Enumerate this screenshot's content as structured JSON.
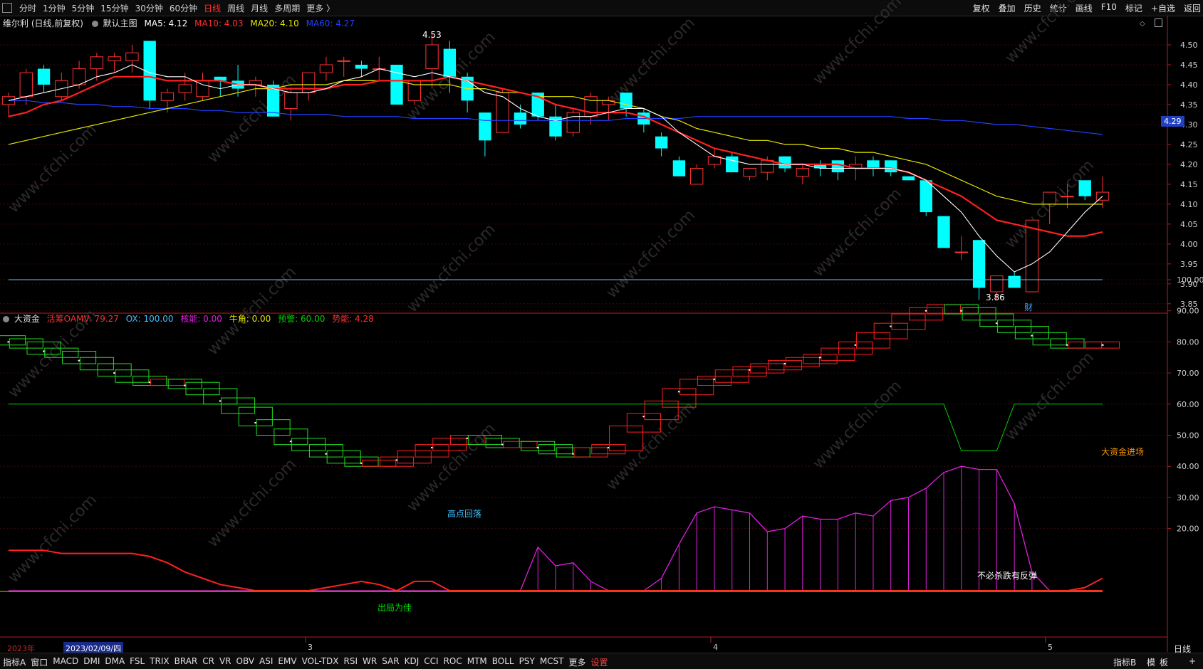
{
  "toolbar": {
    "periods": [
      "分时",
      "1分钟",
      "5分钟",
      "15分钟",
      "30分钟",
      "60分钟",
      "日线",
      "周线",
      "月线",
      "多周期",
      "更多 〉"
    ],
    "active_period": "日线",
    "right_tools": [
      "复权",
      "叠加",
      "历史",
      "统计",
      "画线",
      "F10",
      "标记",
      "+自选",
      "返回"
    ]
  },
  "main_legend": {
    "stock": "维尔利 (日线,前复权)",
    "template": "默认主图",
    "ma5": "MA5: 4.12",
    "ma10": "MA10: 4.03",
    "ma20": "MA20: 4.10",
    "ma60": "MA60: 4.27"
  },
  "sub_legend": {
    "name": "大资金",
    "oamv": "活筹OAMV: 79.27",
    "ox": "OX: 100.00",
    "core": "核能: 0.00",
    "bull": "牛角: 0.00",
    "warn": "预警: 60.00",
    "power": "势能: 4.28"
  },
  "annotations": {
    "high": "4.53",
    "low": "3.86",
    "cai": "财",
    "enter": "大资金进场",
    "pullback": "高点回落",
    "exit": "出局为佳",
    "rebound": "不必杀跌有反弹"
  },
  "current_price": "4.29",
  "date_axis": {
    "year": "2023年",
    "cursor_date": "2023/02/09/四",
    "months": [
      "3",
      "4",
      "5"
    ],
    "period": "日线"
  },
  "indicators": [
    "指标A",
    "窗口",
    "MACD",
    "DMI",
    "DMA",
    "FSL",
    "TRIX",
    "BRAR",
    "CR",
    "VR",
    "OBV",
    "ASI",
    "EMV",
    "VOL-TDX",
    "RSI",
    "WR",
    "SAR",
    "KDJ",
    "CCI",
    "ROC",
    "MTM",
    "BOLL",
    "PSY",
    "MCST",
    "更多",
    "设置"
  ],
  "bottom_right": [
    "指标B",
    "模",
    "板",
    "+"
  ],
  "watermark": "www.cfchi.com",
  "colors": {
    "up": "#ff3232",
    "down": "#00ffff",
    "ma5": "#ffffff",
    "ma10": "#ff2020",
    "ma20": "#e6e600",
    "ma60": "#2040ff",
    "green": "#00d000",
    "magenta": "#e020e0",
    "orange": "#ff9900"
  },
  "chart_data": [
    {
      "type": "candlestick",
      "title": "维尔利 (日线,前复权)",
      "ylim": [
        3.83,
        4.55
      ],
      "y_ticks": [
        4.5,
        4.45,
        4.4,
        4.35,
        4.3,
        4.25,
        4.2,
        4.15,
        4.1,
        4.05,
        4.0,
        3.95,
        3.9,
        3.85
      ],
      "candles": [
        [
          4.35,
          4.38,
          4.32,
          4.37
        ],
        [
          4.37,
          4.44,
          4.35,
          4.43
        ],
        [
          4.44,
          4.45,
          4.38,
          4.4
        ],
        [
          4.37,
          4.43,
          4.36,
          4.41
        ],
        [
          4.4,
          4.46,
          4.39,
          4.44
        ],
        [
          4.44,
          4.48,
          4.41,
          4.47
        ],
        [
          4.46,
          4.48,
          4.43,
          4.47
        ],
        [
          4.46,
          4.5,
          4.43,
          4.48
        ],
        [
          4.51,
          4.51,
          4.34,
          4.36
        ],
        [
          4.36,
          4.39,
          4.33,
          4.38
        ],
        [
          4.38,
          4.43,
          4.36,
          4.4
        ],
        [
          4.37,
          4.43,
          4.36,
          4.41
        ],
        [
          4.42,
          4.42,
          4.37,
          4.41
        ],
        [
          4.41,
          4.45,
          4.37,
          4.39
        ],
        [
          4.4,
          4.42,
          4.37,
          4.41
        ],
        [
          4.4,
          4.41,
          4.32,
          4.32
        ],
        [
          4.34,
          4.39,
          4.31,
          4.38
        ],
        [
          4.38,
          4.43,
          4.36,
          4.43
        ],
        [
          4.43,
          4.47,
          4.41,
          4.45
        ],
        [
          4.46,
          4.47,
          4.42,
          4.46
        ],
        [
          4.45,
          4.46,
          4.42,
          4.44
        ],
        [
          4.44,
          4.47,
          4.41,
          4.44
        ],
        [
          4.45,
          4.45,
          4.35,
          4.35
        ],
        [
          4.36,
          4.41,
          4.35,
          4.41
        ],
        [
          4.44,
          4.53,
          4.39,
          4.5
        ],
        [
          4.49,
          4.51,
          4.38,
          4.42
        ],
        [
          4.42,
          4.43,
          4.33,
          4.36
        ],
        [
          4.33,
          4.33,
          4.22,
          4.26
        ],
        [
          4.28,
          4.39,
          4.28,
          4.38
        ],
        [
          4.33,
          4.35,
          4.29,
          4.3
        ],
        [
          4.38,
          4.38,
          4.31,
          4.32
        ],
        [
          4.32,
          4.35,
          4.26,
          4.27
        ],
        [
          4.28,
          4.34,
          4.27,
          4.33
        ],
        [
          4.32,
          4.38,
          4.3,
          4.37
        ],
        [
          4.35,
          4.37,
          4.31,
          4.36
        ],
        [
          4.38,
          4.38,
          4.32,
          4.34
        ],
        [
          4.33,
          4.34,
          4.28,
          4.3
        ],
        [
          4.27,
          4.28,
          4.22,
          4.24
        ],
        [
          4.21,
          4.22,
          4.17,
          4.17
        ],
        [
          4.15,
          4.2,
          4.15,
          4.19
        ],
        [
          4.2,
          4.24,
          4.19,
          4.22
        ],
        [
          4.22,
          4.23,
          4.18,
          4.18
        ],
        [
          4.17,
          4.19,
          4.16,
          4.19
        ],
        [
          4.18,
          4.22,
          4.16,
          4.21
        ],
        [
          4.22,
          4.22,
          4.18,
          4.19
        ],
        [
          4.17,
          4.2,
          4.15,
          4.19
        ],
        [
          4.2,
          4.21,
          4.17,
          4.19
        ],
        [
          4.21,
          4.21,
          4.16,
          4.18
        ],
        [
          4.19,
          4.22,
          4.16,
          4.2
        ],
        [
          4.21,
          4.22,
          4.17,
          4.19
        ],
        [
          4.21,
          4.21,
          4.17,
          4.18
        ],
        [
          4.17,
          4.17,
          4.16,
          4.16
        ],
        [
          4.16,
          4.16,
          4.07,
          4.08
        ],
        [
          4.07,
          4.07,
          3.99,
          3.99
        ],
        [
          3.98,
          4.02,
          3.96,
          3.98
        ],
        [
          4.01,
          4.01,
          3.86,
          3.89
        ],
        [
          3.88,
          3.92,
          3.86,
          3.92
        ],
        [
          3.92,
          3.93,
          3.89,
          3.89
        ],
        [
          3.88,
          4.06,
          3.88,
          4.06
        ],
        [
          4.1,
          4.13,
          4.05,
          4.13
        ],
        [
          4.12,
          4.15,
          4.09,
          4.12
        ],
        [
          4.16,
          4.16,
          4.11,
          4.12
        ],
        [
          4.11,
          4.17,
          4.09,
          4.13
        ]
      ],
      "ma5": [
        4.36,
        4.37,
        4.38,
        4.39,
        4.4,
        4.42,
        4.43,
        4.45,
        4.43,
        4.42,
        4.42,
        4.4,
        4.39,
        4.4,
        4.4,
        4.39,
        4.38,
        4.38,
        4.39,
        4.41,
        4.42,
        4.44,
        4.43,
        4.42,
        4.43,
        4.42,
        4.41,
        4.38,
        4.37,
        4.34,
        4.32,
        4.31,
        4.32,
        4.32,
        4.33,
        4.34,
        4.34,
        4.32,
        4.28,
        4.25,
        4.22,
        4.21,
        4.2,
        4.2,
        4.2,
        4.2,
        4.19,
        4.19,
        4.19,
        4.19,
        4.19,
        4.18,
        4.16,
        4.12,
        4.08,
        4.02,
        3.97,
        3.93,
        3.95,
        3.98,
        4.03,
        4.08,
        4.12
      ],
      "ma10": [
        4.32,
        4.33,
        4.35,
        4.36,
        4.38,
        4.4,
        4.42,
        4.42,
        4.42,
        4.41,
        4.41,
        4.41,
        4.41,
        4.4,
        4.4,
        4.39,
        4.39,
        4.39,
        4.39,
        4.4,
        4.4,
        4.41,
        4.41,
        4.41,
        4.41,
        4.42,
        4.41,
        4.4,
        4.39,
        4.38,
        4.37,
        4.35,
        4.34,
        4.33,
        4.33,
        4.33,
        4.32,
        4.3,
        4.28,
        4.26,
        4.24,
        4.23,
        4.22,
        4.21,
        4.2,
        4.2,
        4.2,
        4.2,
        4.19,
        4.19,
        4.19,
        4.18,
        4.16,
        4.14,
        4.12,
        4.09,
        4.06,
        4.05,
        4.04,
        4.03,
        4.02,
        4.02,
        4.03
      ],
      "ma20": [
        4.25,
        4.26,
        4.27,
        4.28,
        4.29,
        4.3,
        4.31,
        4.32,
        4.33,
        4.34,
        4.35,
        4.36,
        4.37,
        4.38,
        4.39,
        4.39,
        4.4,
        4.4,
        4.4,
        4.41,
        4.41,
        4.41,
        4.41,
        4.4,
        4.4,
        4.4,
        4.39,
        4.39,
        4.38,
        4.38,
        4.37,
        4.37,
        4.37,
        4.36,
        4.36,
        4.35,
        4.34,
        4.32,
        4.31,
        4.29,
        4.28,
        4.27,
        4.26,
        4.26,
        4.25,
        4.25,
        4.24,
        4.24,
        4.23,
        4.23,
        4.22,
        4.21,
        4.2,
        4.18,
        4.16,
        4.14,
        4.12,
        4.11,
        4.1,
        4.1,
        4.1,
        4.1,
        4.1
      ],
      "ma60": [
        4.36,
        4.36,
        4.355,
        4.355,
        4.35,
        4.35,
        4.345,
        4.345,
        4.34,
        4.34,
        4.34,
        4.335,
        4.335,
        4.33,
        4.33,
        4.33,
        4.325,
        4.325,
        4.325,
        4.32,
        4.32,
        4.32,
        4.32,
        4.315,
        4.315,
        4.315,
        4.315,
        4.31,
        4.31,
        4.31,
        4.31,
        4.31,
        4.31,
        4.31,
        4.31,
        4.315,
        4.315,
        4.315,
        4.315,
        4.32,
        4.32,
        4.32,
        4.32,
        4.32,
        4.32,
        4.32,
        4.32,
        4.32,
        4.32,
        4.32,
        4.32,
        4.315,
        4.315,
        4.31,
        4.31,
        4.305,
        4.3,
        4.3,
        4.295,
        4.29,
        4.285,
        4.28,
        4.275
      ]
    },
    {
      "type": "line",
      "title": "大资金",
      "ylim": [
        0,
        104
      ],
      "y_ticks": [
        100,
        90,
        80,
        70,
        60,
        50,
        40,
        30,
        20
      ],
      "oamv": [
        80,
        79,
        77,
        76,
        74,
        72,
        70,
        68,
        67,
        67,
        66,
        64,
        61,
        58,
        54,
        51,
        48,
        46,
        44,
        42,
        41,
        41,
        42,
        44,
        46,
        48,
        49,
        48,
        47,
        47,
        46,
        45,
        44,
        45,
        46,
        52,
        56,
        60,
        64,
        67,
        68,
        70,
        71,
        72,
        73,
        74,
        75,
        77,
        79,
        82,
        85,
        88,
        90,
        91,
        90,
        88,
        86,
        84,
        82,
        80,
        79,
        79,
        79
      ],
      "warn": [
        60,
        60,
        60,
        60,
        60,
        60,
        60,
        60,
        60,
        60,
        60,
        60,
        60,
        60,
        60,
        60,
        60,
        60,
        60,
        60,
        60,
        60,
        60,
        60,
        60,
        60,
        60,
        60,
        60,
        60,
        60,
        60,
        60,
        60,
        60,
        60,
        60,
        60,
        60,
        60,
        60,
        60,
        60,
        60,
        60,
        60,
        60,
        60,
        60,
        60,
        60,
        60,
        60,
        60,
        45,
        45,
        45,
        60,
        60,
        60,
        60,
        60,
        60
      ],
      "power": [
        13,
        13,
        13,
        12,
        12,
        12,
        12,
        12,
        11,
        9,
        6,
        4,
        2,
        1,
        0,
        0,
        0,
        0,
        1,
        2,
        3,
        2,
        0,
        3,
        3,
        0,
        0,
        0,
        0,
        0,
        0,
        0,
        0,
        0,
        0,
        0,
        0,
        0,
        0,
        0,
        0,
        0,
        0,
        0,
        0,
        0,
        0,
        0,
        0,
        0,
        0,
        0,
        0,
        0,
        0,
        0,
        0,
        0,
        0,
        0,
        0,
        0,
        0
      ],
      "magenta": [
        0,
        0,
        0,
        0,
        0,
        0,
        0,
        0,
        0,
        0,
        0,
        0,
        0,
        0,
        0,
        0,
        0,
        0,
        0,
        0,
        0,
        0,
        0,
        0,
        0,
        0,
        0,
        0,
        0,
        0,
        14,
        8,
        9,
        3,
        0,
        0,
        0,
        4,
        15,
        25,
        27,
        26,
        25,
        19,
        20,
        24,
        23,
        23,
        25,
        24,
        29,
        30,
        33,
        38,
        40,
        39,
        39,
        28,
        6,
        0,
        0,
        0,
        0
      ],
      "ox_ref": 100
    }
  ]
}
